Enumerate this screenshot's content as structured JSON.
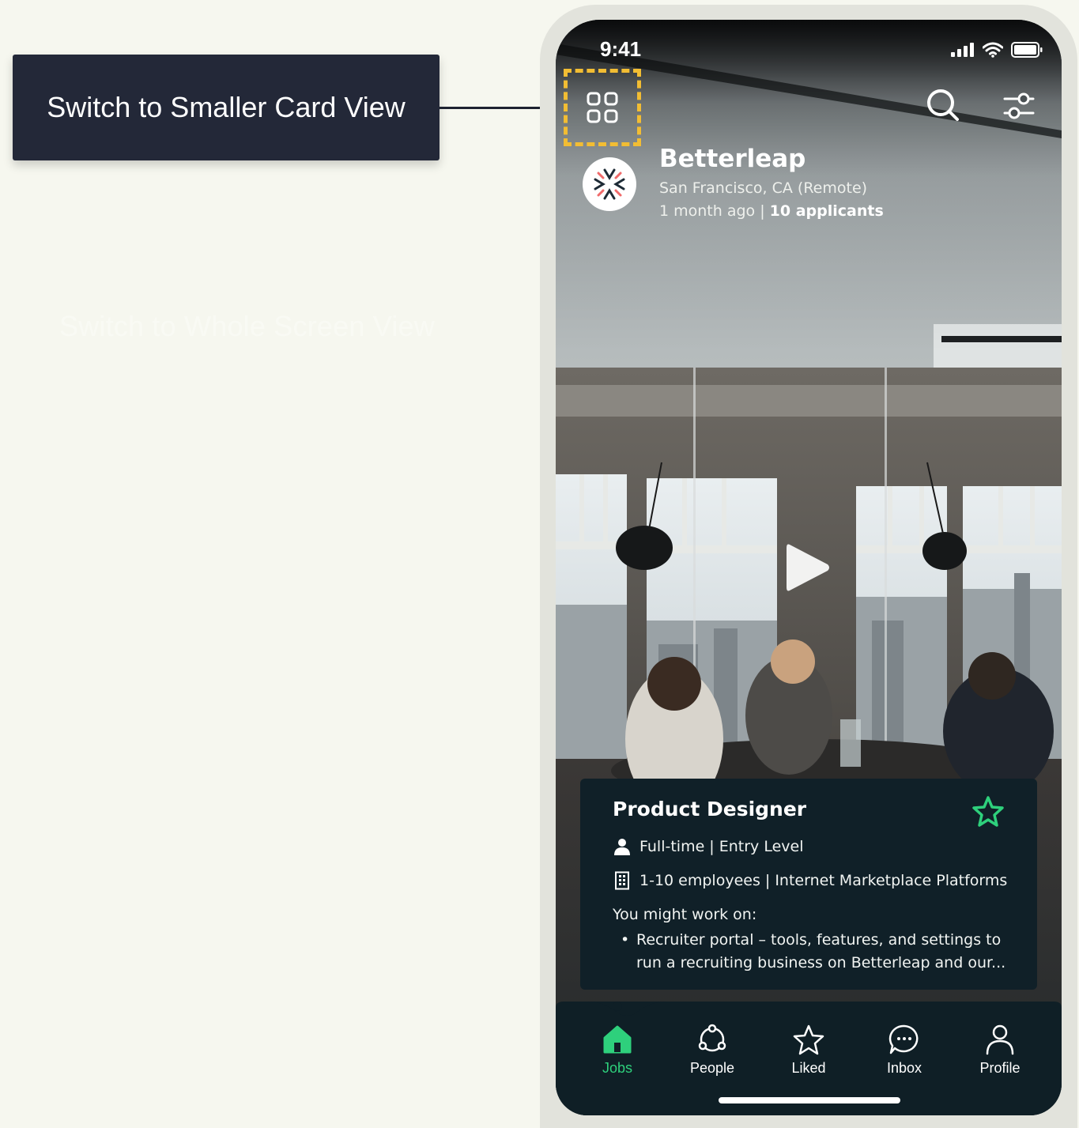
{
  "callout": {
    "label": "Switch to Smaller Card View"
  },
  "ghost_label": "Switch to Whole Screen View",
  "status_bar": {
    "time": "9:41"
  },
  "company": {
    "name": "Betterleap",
    "location": "San Francisco, CA (Remote)",
    "posted": "1 month ago",
    "separator": "|",
    "applicants": "10 applicants"
  },
  "job": {
    "title": "Product Designer",
    "type": "Full-time | Entry Level",
    "company_info": "1-10 employees | Internet Marketplace Platforms",
    "work_heading": "You might work on:",
    "work_bullet": "Recruiter portal – tools, features, and settings to run a recruiting business on Betterleap and our..."
  },
  "tabs": [
    {
      "label": "Jobs",
      "icon": "home-icon",
      "active": true
    },
    {
      "label": "People",
      "icon": "people-icon",
      "active": false
    },
    {
      "label": "Liked",
      "icon": "star-icon",
      "active": false
    },
    {
      "label": "Inbox",
      "icon": "chat-icon",
      "active": false
    },
    {
      "label": "Profile",
      "icon": "user-icon",
      "active": false
    }
  ],
  "colors": {
    "accent": "#2ed07c",
    "highlight": "#f2bd33",
    "card_bg": "#102028",
    "callout_bg": "#232838"
  }
}
